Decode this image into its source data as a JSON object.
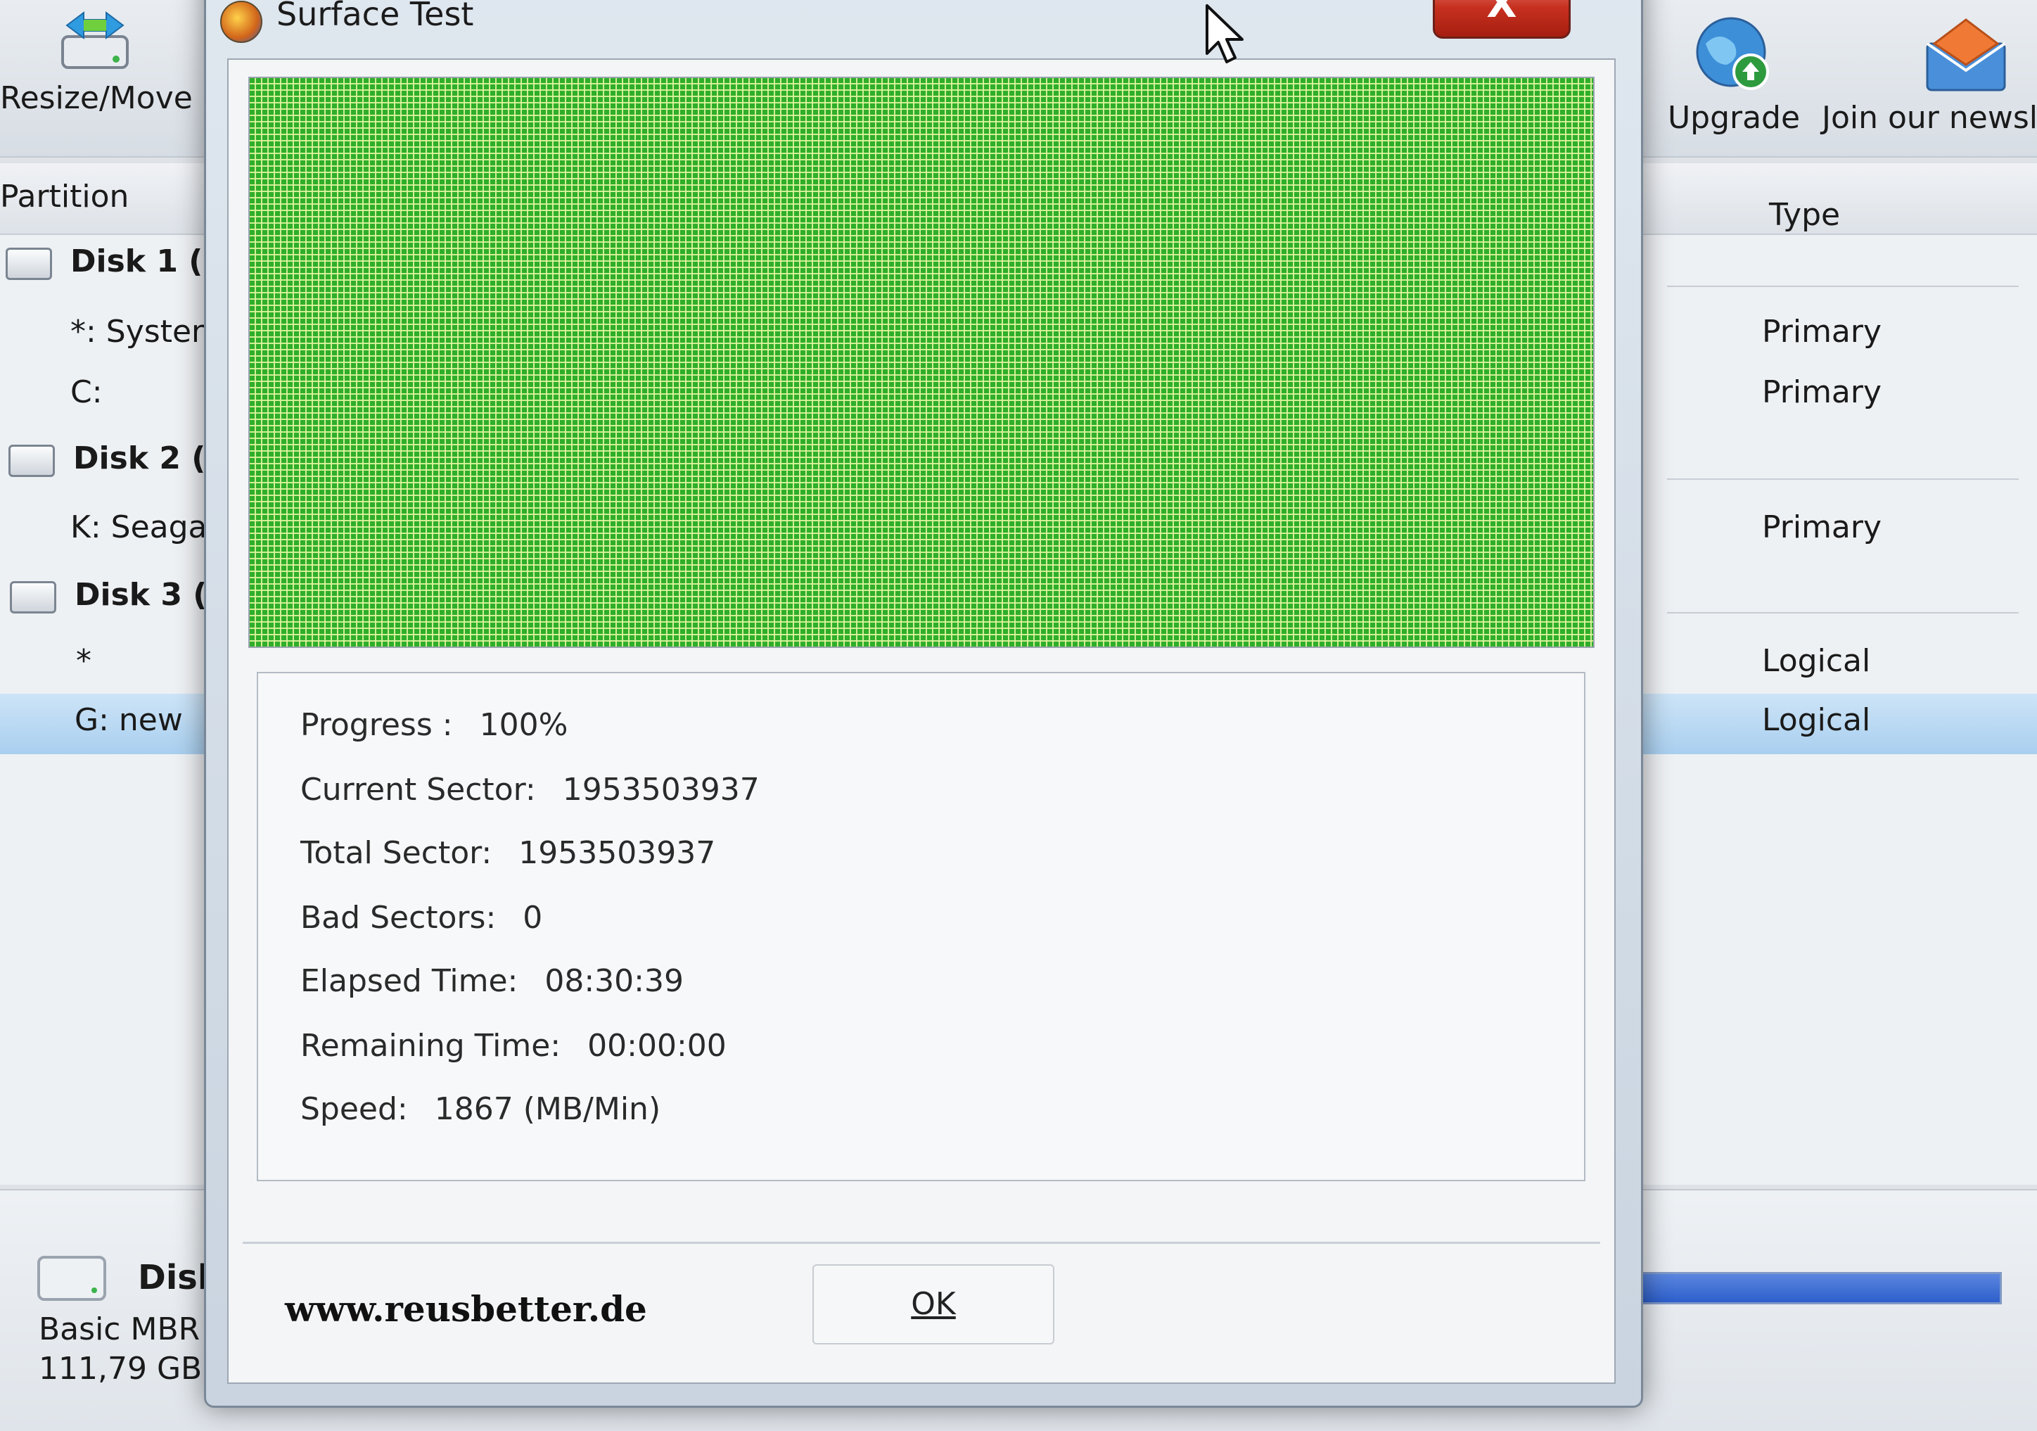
{
  "toolbar": {
    "resize_move": "Resize/Move",
    "upgrade": "Upgrade",
    "newsletter": "Join our newsle"
  },
  "table_header": {
    "partition": "Partition",
    "type": "Type"
  },
  "rows": [
    {
      "name": "Disk 1 (",
      "type": ""
    },
    {
      "name": "*: Systen",
      "type": "Primary"
    },
    {
      "name": "C:",
      "type": "Primary"
    },
    {
      "name": "Disk 2 (",
      "type": ""
    },
    {
      "name": "K: Seaga",
      "type": "Primary"
    },
    {
      "name": "Disk 3 (",
      "type": ""
    },
    {
      "name": "*",
      "type": "Logical"
    },
    {
      "name": "G: new",
      "type": "Logical"
    }
  ],
  "bottom_panel": {
    "disk_name": "Disk",
    "disk_type": "Basic MBR",
    "disk_size": "111,79 GB",
    "bar_fill_fraction": 1.0
  },
  "dialog": {
    "title": "Surface Test",
    "close_label": "X",
    "ok_label": "OK",
    "watermark": "www.reusbetter.de",
    "stats": [
      {
        "label": "Progress :",
        "value": "100%"
      },
      {
        "label": "Current Sector:",
        "value": "1953503937"
      },
      {
        "label": "Total Sector:",
        "value": "1953503937"
      },
      {
        "label": "Bad Sectors:",
        "value": "0"
      },
      {
        "label": "Elapsed Time:",
        "value": "08:30:39"
      },
      {
        "label": "Remaining Time:",
        "value": "00:00:00"
      },
      {
        "label": "Speed:",
        "value": "1867 (MB/Min)"
      }
    ]
  },
  "colors": {
    "surface_ok": "#2fae2a",
    "grid_line": "#e1f5a0",
    "selection": "#a9cfef",
    "close_red": "#c7301f"
  }
}
